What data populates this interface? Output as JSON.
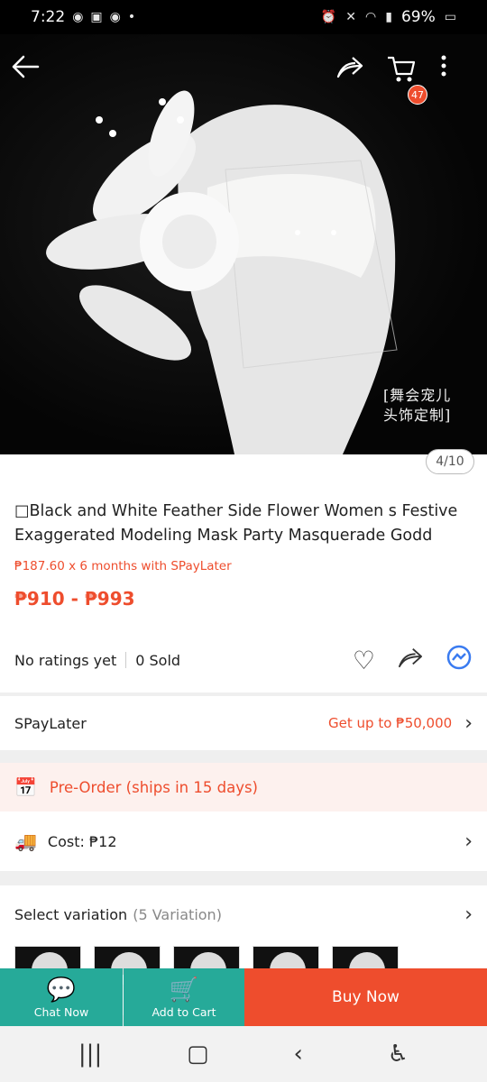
{
  "status_bar": {
    "time": "7:22",
    "left_icons": [
      "messenger-icon",
      "gallery-icon",
      "messenger-icon",
      "dot-icon"
    ],
    "battery": "69%"
  },
  "header": {
    "back_icon": "back-arrow-icon",
    "share_icon": "share-icon",
    "cart_icon": "cart-icon",
    "cart_badge": "47",
    "more_icon": "more-vertical-icon"
  },
  "image": {
    "watermark_line1": "[舞会宠儿",
    "watermark_line2": "头饰定制]",
    "page_indicator": "4/10"
  },
  "product": {
    "title": "□Black and White Feather Side Flower Women s Festive Exaggerated Modeling Mask Party Masquerade Godd",
    "installment": "₱187.60 x 6 months with SPayLater",
    "price": "₱910 - ₱993",
    "ratings": "No ratings yet",
    "sold": "0 Sold"
  },
  "spaylater": {
    "label": "SPayLater",
    "offer": "Get up to ₱50,000"
  },
  "preorder": {
    "text": "Pre-Order (ships in 15 days)"
  },
  "shipping": {
    "text": "Cost: ₱12"
  },
  "variation": {
    "label": "Select variation",
    "count": "(5 Variation)"
  },
  "bottom_bar": {
    "chat_label": "Chat Now",
    "cart_label": "Add to Cart",
    "buy_label": "Buy Now"
  },
  "colors": {
    "brand": "#ee4d2d",
    "teal": "#26aa99"
  }
}
